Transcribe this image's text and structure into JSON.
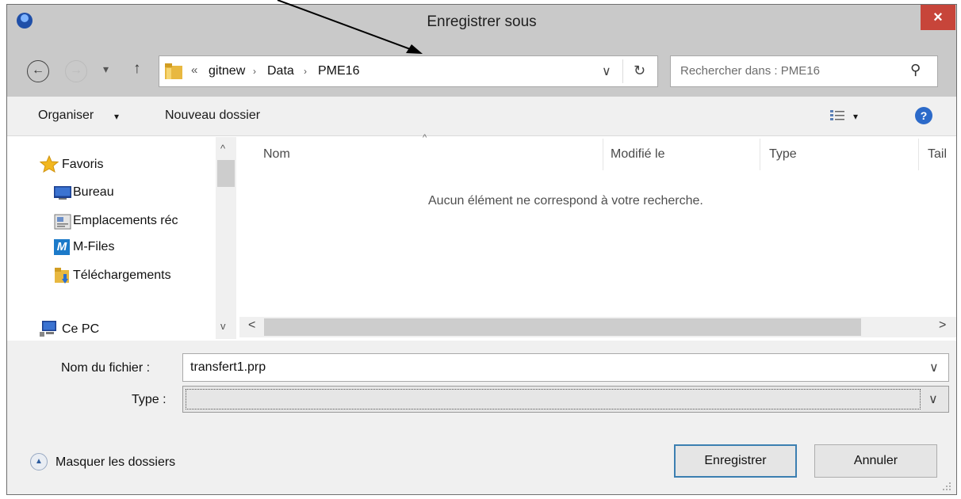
{
  "window": {
    "title": "Enregistrer sous",
    "close_glyph": "×"
  },
  "nav": {
    "back_glyph": "←",
    "forward_glyph": "→",
    "recent_glyph": "▾",
    "up_glyph": "↑",
    "breadcrumb_overflow": "«",
    "breadcrumbs": [
      "gitnew",
      "Data",
      "PME16"
    ],
    "breadcrumb_sep": "›",
    "address_dropdown_glyph": "∨",
    "refresh_glyph": "↻",
    "search_placeholder": "Rechercher dans : PME16",
    "search_glyph": "⚲"
  },
  "toolbar": {
    "organize_label": "Organiser",
    "organize_caret": "▾",
    "new_folder_label": "Nouveau dossier",
    "view_caret": "▾",
    "help_glyph": "?"
  },
  "navpane": {
    "items": [
      {
        "label": "Favoris",
        "icon": "star-icon"
      },
      {
        "label": "Bureau",
        "icon": "desktop-icon"
      },
      {
        "label": "Emplacements réc",
        "icon": "recent-places-icon"
      },
      {
        "label": "M-Files",
        "icon": "mfiles-icon"
      },
      {
        "label": "Téléchargements",
        "icon": "downloads-folder-icon"
      },
      {
        "label": "Ce PC",
        "icon": "computer-icon"
      }
    ],
    "scroll_up": "^",
    "scroll_down": "v"
  },
  "content": {
    "columns": [
      "Nom",
      "Modifié le",
      "Type",
      "Tail"
    ],
    "sort_indicator": "^",
    "empty_message": "Aucun élément ne correspond à votre recherche.",
    "scroll_left": "<",
    "scroll_right": ">"
  },
  "form": {
    "filename_label": "Nom du fichier :",
    "filename_value": "transfert1.prp",
    "type_label": "Type :",
    "type_value": "",
    "dropdown_glyph": "∨"
  },
  "footer": {
    "hide_folders_label": "Masquer les dossiers",
    "hide_folders_glyph": "▲",
    "save_label": "Enregistrer",
    "cancel_label": "Annuler"
  },
  "colors": {
    "title_bar": "#c9c9c9",
    "close_button": "#c7453a",
    "folder": "#e8b840",
    "accent_border": "#3c7fb1"
  }
}
